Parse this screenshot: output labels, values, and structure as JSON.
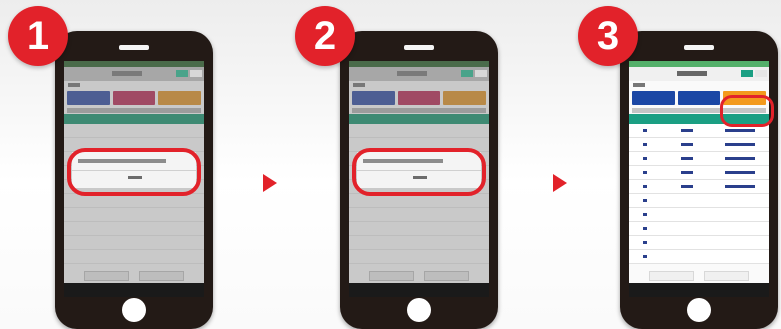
{
  "steps": [
    {
      "number": "1",
      "highlight": "dialog"
    },
    {
      "number": "2",
      "highlight": "dialog"
    },
    {
      "number": "3",
      "highlight": "top-right-button"
    }
  ],
  "colors": {
    "accent_red": "#e2222a",
    "phone_body": "#231a16",
    "table_header_teal": "#1b9f83",
    "button_blue": "#1b47a5",
    "button_orange": "#f39a1d"
  },
  "icons": [
    "arrow-right-icon",
    "arrow-right-icon"
  ]
}
